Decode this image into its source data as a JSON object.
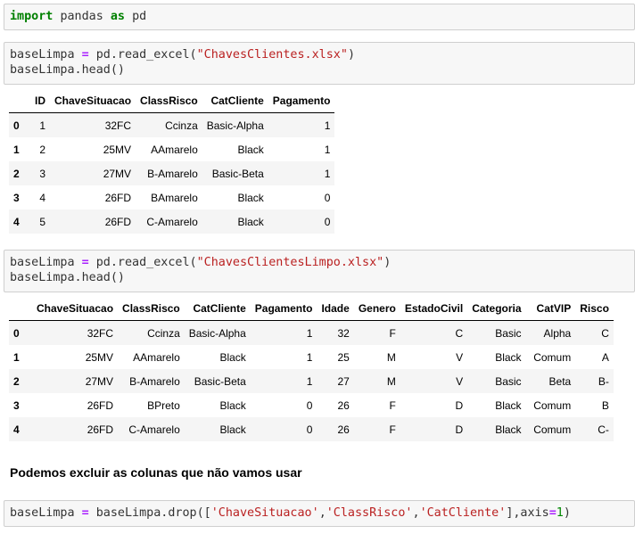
{
  "cells": {
    "c1": {
      "tokens": [
        "import",
        "pandas",
        "as",
        "pd"
      ]
    },
    "c2": {
      "line1": {
        "var": "baseLimpa",
        "eq": "=",
        "call": "pd.read_excel(",
        "arg": "\"ChavesClientes.xlsx\"",
        "close": ")"
      },
      "line2": "baseLimpa.head()"
    },
    "c3": {
      "line1": {
        "var": "baseLimpa",
        "eq": "=",
        "call": "pd.read_excel(",
        "arg": "\"ChavesClientesLimpo.xlsx\"",
        "close": ")"
      },
      "line2": "baseLimpa.head()"
    },
    "c4": {
      "pre": "baseLimpa",
      "eq": "=",
      "call": "baseLimpa.drop([",
      "a1": "'ChaveSituacao'",
      "sep1": ",",
      "a2": "'ClassRisco'",
      "sep2": ",",
      "a3": "'CatCliente'",
      "mid": "],axis",
      "eq2": "=",
      "num": "1",
      "close": ")"
    }
  },
  "table1": {
    "columns": [
      "",
      "ID",
      "ChaveSituacao",
      "ClassRisco",
      "CatCliente",
      "Pagamento"
    ],
    "rows": [
      [
        "0",
        "1",
        "32FC",
        "Ccinza",
        "Basic-Alpha",
        "1"
      ],
      [
        "1",
        "2",
        "25MV",
        "AAmarelo",
        "Black",
        "1"
      ],
      [
        "2",
        "3",
        "27MV",
        "B-Amarelo",
        "Basic-Beta",
        "1"
      ],
      [
        "3",
        "4",
        "26FD",
        "BAmarelo",
        "Black",
        "0"
      ],
      [
        "4",
        "5",
        "26FD",
        "C-Amarelo",
        "Black",
        "0"
      ]
    ]
  },
  "table2": {
    "columns": [
      "",
      "ChaveSituacao",
      "ClassRisco",
      "CatCliente",
      "Pagamento",
      "Idade",
      "Genero",
      "EstadoCivil",
      "Categoria",
      "CatVIP",
      "Risco"
    ],
    "rows": [
      [
        "0",
        "32FC",
        "Ccinza",
        "Basic-Alpha",
        "1",
        "32",
        "F",
        "C",
        "Basic",
        "Alpha",
        "C"
      ],
      [
        "1",
        "25MV",
        "AAmarelo",
        "Black",
        "1",
        "25",
        "M",
        "V",
        "Black",
        "Comum",
        "A"
      ],
      [
        "2",
        "27MV",
        "B-Amarelo",
        "Basic-Beta",
        "1",
        "27",
        "M",
        "V",
        "Basic",
        "Beta",
        "B-"
      ],
      [
        "3",
        "26FD",
        "BPreto",
        "Black",
        "0",
        "26",
        "F",
        "D",
        "Black",
        "Comum",
        "B"
      ],
      [
        "4",
        "26FD",
        "C-Amarelo",
        "Black",
        "0",
        "26",
        "F",
        "D",
        "Black",
        "Comum",
        "C-"
      ]
    ]
  },
  "markdown": "Podemos excluir as colunas que não vamos usar"
}
